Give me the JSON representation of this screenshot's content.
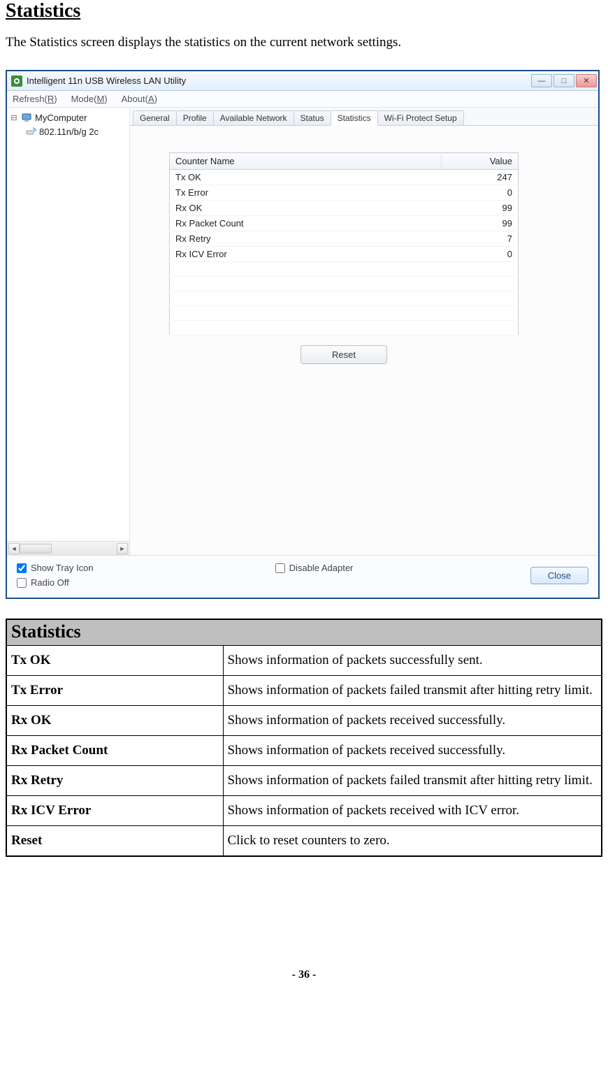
{
  "doc": {
    "heading": "Statistics",
    "intro": "The Statistics screen displays the statistics on the current network settings.",
    "page_num": "- 36 -"
  },
  "app": {
    "title": "Intelligent 11n USB Wireless LAN Utility",
    "menus": {
      "refresh": "Refresh(R)",
      "mode": "Mode(M)",
      "about": "About(A)"
    },
    "tree": {
      "root": "MyComputer",
      "child": "802.11n/b/g 2c"
    },
    "tabs": {
      "general": "General",
      "profile": "Profile",
      "available": "Available Network",
      "status": "Status",
      "statistics": "Statistics",
      "wps": "Wi-Fi Protect Setup"
    },
    "stats": {
      "col_name": "Counter Name",
      "col_value": "Value",
      "rows": [
        {
          "name": "Tx OK",
          "value": "247"
        },
        {
          "name": "Tx Error",
          "value": "0"
        },
        {
          "name": "Rx OK",
          "value": "99"
        },
        {
          "name": "Rx Packet Count",
          "value": "99"
        },
        {
          "name": "Rx Retry",
          "value": "7"
        },
        {
          "name": "Rx ICV Error",
          "value": "0"
        }
      ],
      "reset": "Reset"
    },
    "bottom": {
      "show_tray": "Show Tray Icon",
      "radio_off": "Radio Off",
      "disable_adapter": "Disable Adapter",
      "close": "Close"
    }
  },
  "explain": {
    "title": "Statistics",
    "rows": [
      {
        "k": "Tx OK",
        "v": "Shows information of packets successfully sent."
      },
      {
        "k": "Tx Error",
        "v": "Shows information of packets failed transmit after hitting retry limit."
      },
      {
        "k": "Rx OK",
        "v": "Shows information of packets received successfully."
      },
      {
        "k": "Rx Packet Count",
        "v": "Shows information of packets received successfully."
      },
      {
        "k": "Rx Retry",
        "v": "Shows information of packets failed transmit after hitting retry limit."
      },
      {
        "k": "Rx ICV Error",
        "v": "Shows information of packets received with ICV error."
      },
      {
        "k": "Reset",
        "v": "Click to reset counters to zero."
      }
    ]
  }
}
